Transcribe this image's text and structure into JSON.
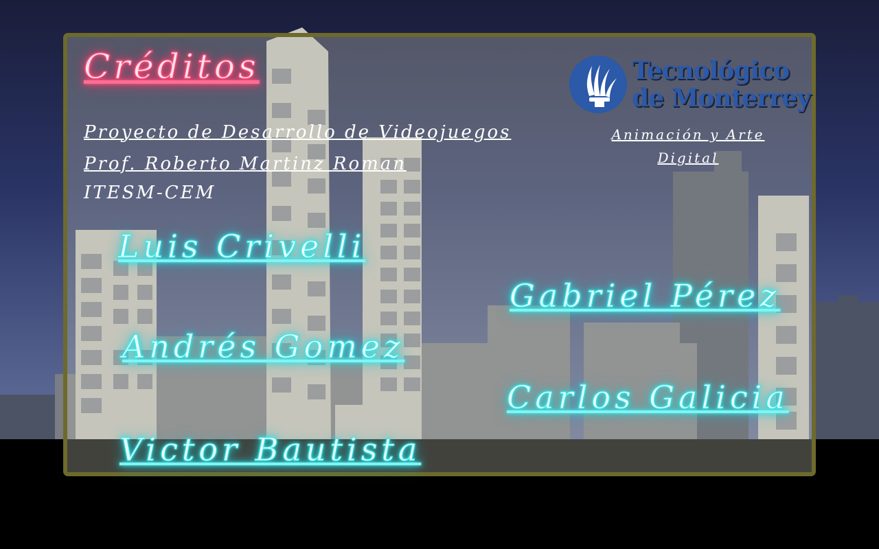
{
  "credits": {
    "title": "Créditos",
    "course_line": "Proyecto de Desarrollo de Videojuegos",
    "professor_line": "Prof. Roberto Martinz Roman",
    "campus_line": "ITESM-CEM"
  },
  "institution": {
    "logo_line1": "Tecnológico",
    "logo_line2": "de Monterrey",
    "dept_line1": "Animación y Arte",
    "dept_line2": "Digital"
  },
  "team": [
    "Luis Crivelli",
    "Gabriel Pérez",
    "Andrés Gomez",
    "Carlos Galicia",
    "Victor Bautista"
  ],
  "colors": {
    "sky_top": "#1a1d3a",
    "sky_bottom": "#5d6a96",
    "panel_border": "#6e6a2c",
    "neon_pink": "#ff4f7e",
    "neon_cyan": "#3fe6e6",
    "logo_blue": "#2c59a8"
  }
}
